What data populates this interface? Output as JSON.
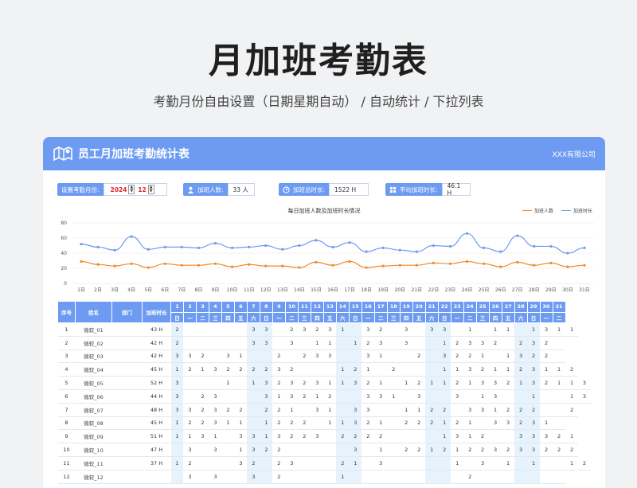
{
  "hero": {
    "title": "月加班考勤表",
    "subtitle": "考勤月份自由设置（日期星期自动） /  自动统计  /  下拉列表"
  },
  "card": {
    "title": "员工月加班考勤统计表",
    "company": "XXX有限公司",
    "logo_icon": "map-icon"
  },
  "info": {
    "month_label": "设置考勤月份:",
    "year": "2024",
    "month": "12",
    "people_label": "加班人数:",
    "people_value": "33 人",
    "total_label": "加班总时长:",
    "total_value": "1522 H",
    "avg_label": "平均加班时长:",
    "avg_value": "46.1 H"
  },
  "chart_data": {
    "type": "line",
    "title": "每日加班人数及加班时长情况",
    "categories": [
      "1日",
      "2日",
      "3日",
      "4日",
      "5日",
      "6日",
      "7日",
      "8日",
      "9日",
      "10日",
      "11日",
      "12日",
      "13日",
      "14日",
      "15日",
      "16日",
      "17日",
      "18日",
      "19日",
      "20日",
      "21日",
      "22日",
      "23日",
      "24日",
      "25日",
      "26日",
      "27日",
      "28日",
      "29日",
      "30日",
      "31日"
    ],
    "yticks": [
      "0",
      "20",
      "40",
      "60",
      "80"
    ],
    "ylim": [
      0,
      80
    ],
    "series": [
      {
        "name": "加班人数",
        "color": "#f08a2c",
        "values": [
          29,
          25,
          23,
          26,
          21,
          26,
          24,
          24,
          26,
          22,
          25,
          23,
          23,
          21,
          28,
          24,
          29,
          21,
          23,
          24,
          24,
          27,
          26,
          29,
          26,
          22,
          28,
          24,
          27,
          22,
          24
        ]
      },
      {
        "name": "加班时长",
        "color": "#6e9bf2",
        "values": [
          52,
          48,
          44,
          62,
          45,
          48,
          48,
          47,
          53,
          47,
          48,
          50,
          45,
          50,
          57,
          48,
          54,
          42,
          47,
          44,
          42,
          50,
          49,
          66,
          47,
          42,
          63,
          49,
          49,
          40,
          47
        ]
      }
    ],
    "legend": "top-right",
    "grid": true
  },
  "table": {
    "headers": {
      "seq": "序号",
      "name": "姓名",
      "dept": "部门",
      "hours": "加班时长"
    },
    "days": [
      "1",
      "2",
      "3",
      "4",
      "5",
      "6",
      "7",
      "8",
      "9",
      "10",
      "11",
      "12",
      "13",
      "14",
      "15",
      "16",
      "17",
      "18",
      "19",
      "20",
      "21",
      "22",
      "23",
      "24",
      "25",
      "26",
      "27",
      "28",
      "29",
      "30",
      "31"
    ],
    "weekdays": [
      "日",
      "一",
      "二",
      "三",
      "四",
      "五",
      "六",
      "日",
      "一",
      "二",
      "三",
      "四",
      "五",
      "六",
      "日",
      "一",
      "二",
      "三",
      "四",
      "五",
      "六",
      "日",
      "一",
      "二",
      "三",
      "四",
      "五",
      "六",
      "日",
      "一",
      "二"
    ],
    "weekend_days": [
      1,
      7,
      8,
      14,
      15,
      21,
      22,
      28,
      29
    ],
    "rows": [
      {
        "seq": "1",
        "name": "微软_01",
        "dept": "",
        "hours": "43 H",
        "d": [
          "2",
          "",
          "",
          "",
          "",
          "",
          "3",
          "3",
          "",
          "2",
          "3",
          "2",
          "3",
          "1",
          "",
          "3",
          "2",
          "",
          "3",
          "",
          "3",
          "3",
          "",
          "1",
          "",
          "1",
          "1",
          "",
          "1",
          "3",
          "1",
          "1"
        ]
      },
      {
        "seq": "2",
        "name": "微软_02",
        "dept": "",
        "hours": "42 H",
        "d": [
          "2",
          "",
          "",
          "",
          "",
          "",
          "3",
          "3",
          "",
          "3",
          "",
          "1",
          "1",
          "",
          "1",
          "2",
          "3",
          "",
          "3",
          "",
          "",
          "1",
          "2",
          "3",
          "3",
          "2",
          "",
          "2",
          "3",
          "2",
          ""
        ]
      },
      {
        "seq": "3",
        "name": "微软_03",
        "dept": "",
        "hours": "42 H",
        "d": [
          "3",
          "3",
          "2",
          "",
          "3",
          "1",
          "",
          "",
          "2",
          "",
          "2",
          "3",
          "3",
          "",
          "",
          "3",
          "1",
          "",
          "",
          "2",
          "",
          "3",
          "2",
          "2",
          "1",
          "",
          "1",
          "3",
          "2",
          "2",
          ""
        ]
      },
      {
        "seq": "4",
        "name": "微软_04",
        "dept": "",
        "hours": "45 H",
        "d": [
          "1",
          "2",
          "1",
          "3",
          "2",
          "2",
          "2",
          "2",
          "3",
          "2",
          "",
          "",
          "",
          "1",
          "2",
          "1",
          "",
          "2",
          "",
          "",
          "",
          "1",
          "1",
          "3",
          "2",
          "1",
          "1",
          "2",
          "3",
          "1",
          "1",
          "2"
        ]
      },
      {
        "seq": "5",
        "name": "微软_05",
        "dept": "",
        "hours": "52 H",
        "d": [
          "3",
          "",
          "",
          "",
          "1",
          "",
          "1",
          "3",
          "2",
          "3",
          "2",
          "3",
          "1",
          "1",
          "3",
          "2",
          "1",
          "",
          "1",
          "2",
          "1",
          "1",
          "2",
          "1",
          "3",
          "3",
          "2",
          "1",
          "3",
          "2",
          "1",
          "1",
          "3"
        ]
      },
      {
        "seq": "6",
        "name": "微软_06",
        "dept": "",
        "hours": "44 H",
        "d": [
          "3",
          "",
          "2",
          "3",
          "",
          "",
          "",
          "3",
          "1",
          "3",
          "2",
          "1",
          "2",
          "",
          "",
          "3",
          "3",
          "1",
          "",
          "3",
          "",
          "",
          "3",
          "",
          "1",
          "3",
          "",
          "",
          "1",
          "",
          "",
          "1",
          "3"
        ]
      },
      {
        "seq": "7",
        "name": "微软_07",
        "dept": "",
        "hours": "48 H",
        "d": [
          "3",
          "3",
          "2",
          "3",
          "2",
          "2",
          "",
          "2",
          "2",
          "1",
          "",
          "3",
          "1",
          "",
          "3",
          "3",
          "",
          "",
          "1",
          "1",
          "2",
          "2",
          "",
          "3",
          "3",
          "1",
          "2",
          "2",
          "2",
          "",
          "",
          "2"
        ]
      },
      {
        "seq": "8",
        "name": "微软_08",
        "dept": "",
        "hours": "45 H",
        "d": [
          "1",
          "2",
          "2",
          "3",
          "1",
          "1",
          "",
          "1",
          "2",
          "2",
          "2",
          "",
          "1",
          "1",
          "3",
          "2",
          "1",
          "",
          "2",
          "2",
          "2",
          "1",
          "2",
          "1",
          "",
          "3",
          "3",
          "2",
          "3",
          "1",
          ""
        ]
      },
      {
        "seq": "9",
        "name": "微软_09",
        "dept": "",
        "hours": "51 H",
        "d": [
          "1",
          "1",
          "3",
          "1",
          "",
          "3",
          "3",
          "1",
          "3",
          "2",
          "2",
          "3",
          "",
          "2",
          "2",
          "2",
          "2",
          "",
          "",
          "",
          "",
          "1",
          "3",
          "1",
          "2",
          "",
          "",
          "3",
          "3",
          "3",
          "2",
          "1"
        ]
      },
      {
        "seq": "10",
        "name": "微软_10",
        "dept": "",
        "hours": "47 H",
        "d": [
          "",
          "3",
          "",
          "3",
          "",
          "1",
          "3",
          "2",
          "2",
          "",
          "",
          "",
          "",
          "",
          "3",
          "",
          "1",
          "",
          "2",
          "2",
          "1",
          "2",
          "1",
          "2",
          "2",
          "3",
          "2",
          "3",
          "3",
          "2",
          "2",
          "2"
        ]
      },
      {
        "seq": "11",
        "name": "微软_11",
        "dept": "",
        "hours": "37 H",
        "d": [
          "1",
          "2",
          "",
          "",
          "",
          "3",
          "2",
          "",
          "2",
          "3",
          "",
          "",
          "",
          "2",
          "1",
          "",
          "3",
          "",
          "",
          "",
          "",
          "",
          "1",
          "",
          "3",
          "",
          "1",
          "",
          "1",
          "",
          "",
          "1",
          "2"
        ]
      },
      {
        "seq": "12",
        "name": "微软_12",
        "dept": "",
        "hours": "",
        "d": [
          "",
          "3",
          "",
          "3",
          "",
          "",
          "3",
          "",
          "2",
          "",
          "",
          "",
          "",
          "1",
          "",
          "",
          "",
          "",
          "",
          "",
          "",
          "",
          "",
          "2",
          "",
          "",
          "",
          "",
          "",
          "",
          ""
        ]
      }
    ]
  }
}
